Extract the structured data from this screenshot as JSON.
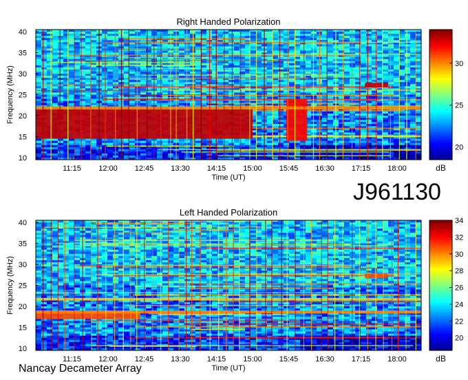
{
  "observation_id": "J961130",
  "observatory": "Nancay Decameter Array",
  "colormap": [
    "#00008f",
    "#0000ff",
    "#0080ff",
    "#00ffff",
    "#80ff80",
    "#ffff00",
    "#ff8000",
    "#ff0000",
    "#800000"
  ],
  "chart_data": [
    {
      "type": "heatmap",
      "title": "Right Handed Polarization",
      "xlabel": "Time (UT)",
      "ylabel": "Frequency (MHz)",
      "x_ticks": [
        "11:15",
        "12:00",
        "12:45",
        "13:30",
        "14:15",
        "15:00",
        "15:45",
        "16:30",
        "17:15",
        "18:00"
      ],
      "x_tick_minutes": [
        675,
        720,
        765,
        810,
        855,
        900,
        945,
        990,
        1035,
        1080
      ],
      "xlim_minutes": [
        630,
        1110
      ],
      "ylim": [
        9.5,
        40.5
      ],
      "y_ticks": [
        10,
        15,
        20,
        25,
        30,
        35,
        40
      ],
      "colorbar": {
        "unit": "dB",
        "range": [
          18.5,
          34
        ],
        "ticks": [
          20,
          25,
          30
        ]
      },
      "features": [
        {
          "name": "intense band",
          "t": [
            630,
            900
          ],
          "f": [
            14.5,
            21.5
          ],
          "db": 33
        },
        {
          "name": "burst",
          "t": [
            942,
            968
          ],
          "f": [
            14,
            24
          ],
          "db": 32
        },
        {
          "name": "emission",
          "t": [
            1040,
            1068
          ],
          "f": [
            26.7,
            27.8
          ],
          "db": 33
        },
        {
          "name": "interference line",
          "t": [
            630,
            1110
          ],
          "f": [
            21.5,
            22.2
          ],
          "db": 30
        }
      ]
    },
    {
      "type": "heatmap",
      "title": "Left Handed Polarization",
      "xlabel": "Time (UT)",
      "ylabel": "Frequency (MHz)",
      "x_ticks": [
        "11:15",
        "12:00",
        "12:45",
        "13:30",
        "14:15",
        "15:00",
        "15:45",
        "16:30",
        "17:15",
        "18:00"
      ],
      "x_tick_minutes": [
        675,
        720,
        765,
        810,
        855,
        900,
        945,
        990,
        1035,
        1080
      ],
      "xlim_minutes": [
        630,
        1110
      ],
      "ylim": [
        9.5,
        40.5
      ],
      "y_ticks": [
        10,
        15,
        20,
        25,
        30,
        35,
        40
      ],
      "colorbar": {
        "unit": "dB",
        "range": [
          18.5,
          34
        ],
        "ticks": [
          20,
          22,
          24,
          26,
          28,
          30,
          32,
          34
        ]
      },
      "features": [
        {
          "name": "band",
          "t": [
            630,
            760
          ],
          "f": [
            17,
            19
          ],
          "db": 31
        },
        {
          "name": "emission",
          "t": [
            1040,
            1068
          ],
          "f": [
            26.7,
            27.8
          ],
          "db": 31
        },
        {
          "name": "interference line",
          "t": [
            630,
            1110
          ],
          "f": [
            21.4,
            22
          ],
          "db": 29
        },
        {
          "name": "interference line",
          "t": [
            630,
            1110
          ],
          "f": [
            18.3,
            19
          ],
          "db": 30
        }
      ]
    }
  ]
}
